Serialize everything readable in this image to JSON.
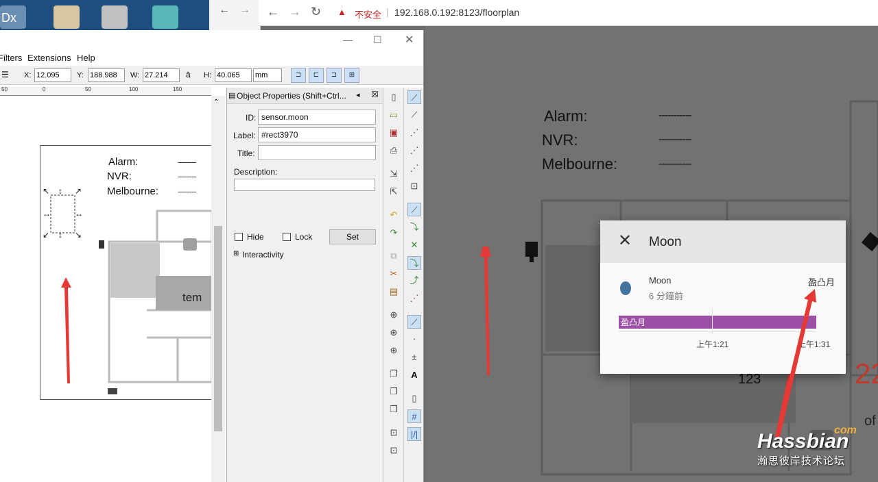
{
  "desktop": {
    "icon_text": "Dx"
  },
  "browser": {
    "security_label": "不安全",
    "url": "192.168.0.192:8123/floorplan"
  },
  "inkscape": {
    "menu": {
      "filters": "Filters",
      "extensions": "Extensions",
      "help": "Help"
    },
    "toolbar": {
      "x_label": "X:",
      "x_value": "12.095",
      "y_label": "Y:",
      "y_value": "188.988",
      "w_label": "W:",
      "w_value": "27.214",
      "h_label": "H:",
      "h_value": "40.065",
      "unit": "mm"
    },
    "ruler_ticks": [
      "50",
      "0",
      "50",
      "100",
      "150"
    ],
    "canvas": {
      "alarm": "Alarm:",
      "nvr": "NVR:",
      "melbourne": "Melbourne:",
      "dashes": "--------",
      "room_label": "tem"
    },
    "object_properties": {
      "title": "Object Properties (Shift+Ctrl...",
      "id_label": "ID:",
      "id_value": "sensor.moon",
      "label_label": "Label:",
      "label_value": "#rect3970",
      "title_label": "Title:",
      "title_value": "",
      "description_label": "Description:",
      "hide_label": "Hide",
      "lock_label": "Lock",
      "set_button": "Set",
      "interactivity": "Interactivity"
    }
  },
  "floorplan": {
    "alarm": "Alarm:",
    "nvr": "NVR:",
    "melbourne": "Melbourne:",
    "dashes": "-----------",
    "room_number": "123",
    "side_number": "22",
    "side_text": "of"
  },
  "dialog": {
    "title": "Moon",
    "entity_name": "Moon",
    "last_changed": "6 分鐘前",
    "state": "盈凸月",
    "dot_color": "#44739e",
    "history_bar_label": "盈凸月",
    "history_bar_color": "#9b4fa5",
    "axis_ticks": [
      "上午1:21",
      "上午1:31"
    ]
  },
  "watermark": {
    "brand": "Hassbian",
    "com": "com",
    "subtitle": "瀚思彼岸技术论坛"
  }
}
